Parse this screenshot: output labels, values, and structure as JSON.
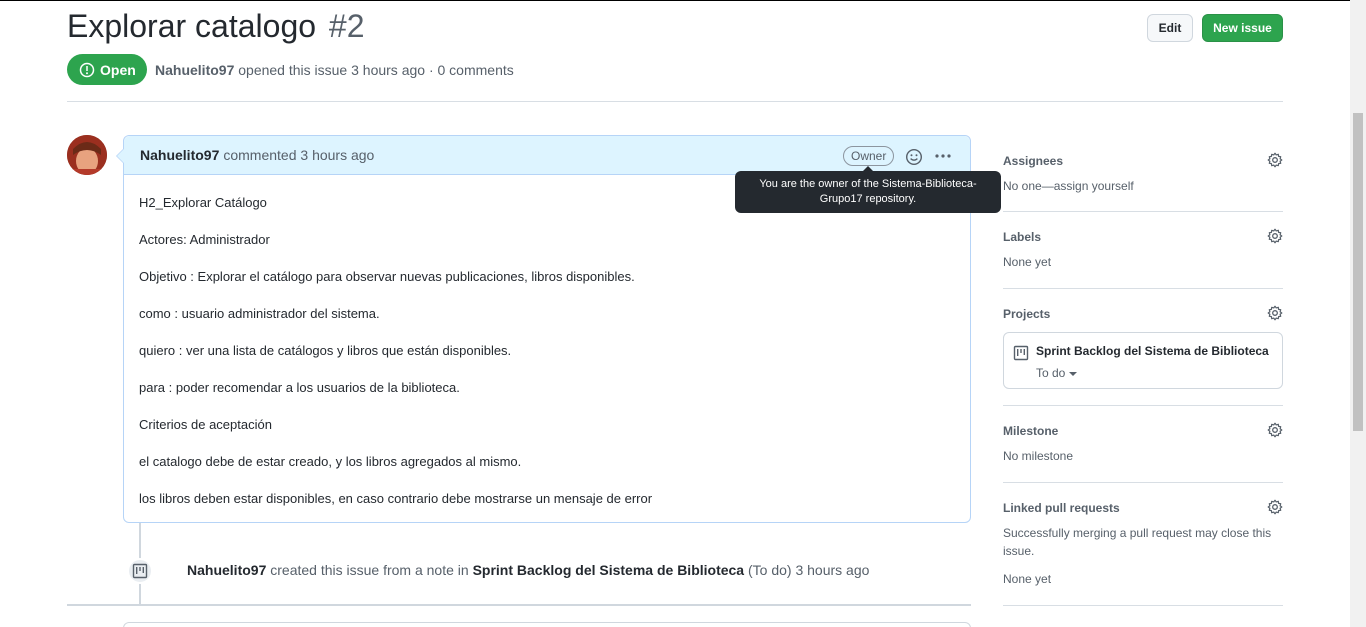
{
  "issue": {
    "title": "Explorar catalogo",
    "number": "#2",
    "state": "Open",
    "author": "Nahuelito97",
    "meta_rest": "opened this issue 3 hours ago · 0 comments"
  },
  "header_buttons": {
    "edit_label": "Edit",
    "new_issue_label": "New issue"
  },
  "comment": {
    "author": "Nahuelito97",
    "time_text": "commented 3 hours ago",
    "role_label": "Owner",
    "tooltip": "You are the owner of the Sistema-Biblioteca-Grupo17 repository.",
    "body": [
      "H2_Explorar Catálogo",
      "Actores: Administrador",
      "Objetivo : Explorar el catálogo para observar nuevas publicaciones, libros disponibles.",
      "como : usuario administrador del sistema.",
      "quiero : ver una lista de catálogos y libros que están disponibles.",
      "para : poder recomendar a los usuarios de la biblioteca.",
      "Criterios de aceptación",
      "el catalogo debe de estar creado, y los libros agregados al mismo.",
      "los libros deben estar disponibles, en caso contrario debe mostrarse un mensaje de error"
    ]
  },
  "timeline_event": {
    "actor": "Nahuelito97",
    "action": "created this issue from a note in",
    "project": "Sprint Backlog del Sistema de Biblioteca",
    "column": "(To do)",
    "time": "3 hours ago"
  },
  "sidebar": {
    "assignees": {
      "title": "Assignees",
      "value": "No one—assign yourself"
    },
    "labels": {
      "title": "Labels",
      "value": "None yet"
    },
    "projects": {
      "title": "Projects",
      "project_name": "Sprint Backlog del Sistema de Biblioteca",
      "column": "To do"
    },
    "milestone": {
      "title": "Milestone",
      "value": "No milestone"
    },
    "linked_prs": {
      "title": "Linked pull requests",
      "description": "Successfully merging a pull request may close this issue.",
      "value": "None yet"
    }
  },
  "colors": {
    "open_green": "#2da44e",
    "comment_header_bg": "#ddf4ff",
    "tooltip_bg": "#24292f"
  }
}
